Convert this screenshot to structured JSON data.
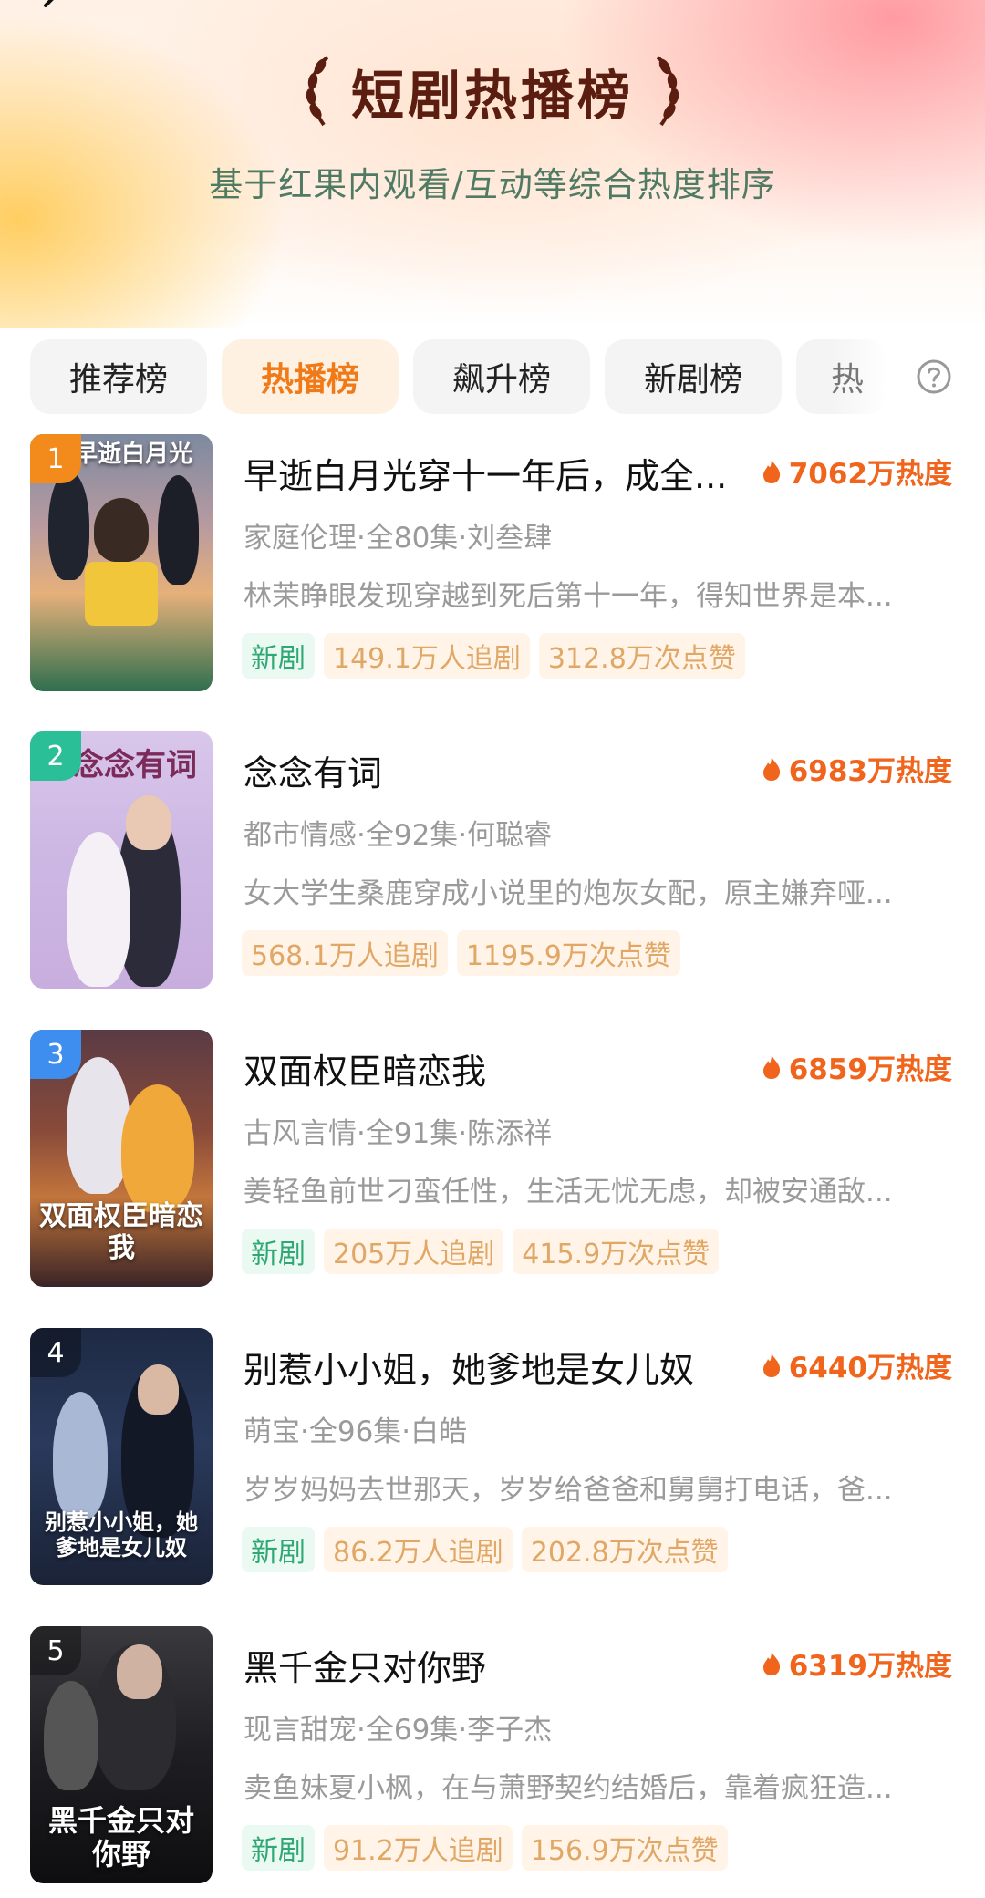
{
  "header": {
    "title": "短剧热播榜",
    "subtitle": "基于红果内观看/互动等综合热度排序"
  },
  "tabs": [
    {
      "label": "推荐榜"
    },
    {
      "label": "热播榜"
    },
    {
      "label": "飙升榜"
    },
    {
      "label": "新剧榜"
    },
    {
      "label": "热"
    }
  ],
  "active_tab": "热播榜",
  "accent_color": "#f0641c",
  "items": [
    {
      "rank": "1",
      "rank_color": "#f28a1c",
      "poster_text": "早逝白月光",
      "title": "早逝白月光穿十一年后，成全...",
      "heat": "7062万热度",
      "meta": "家庭伦理·全80集·刘叁肆",
      "desc": "林茉睁眼发现穿越到死后第十一年，得知世界是本...",
      "tag_new": "新剧",
      "followers": "149.1万人追剧",
      "likes": "312.8万次点赞"
    },
    {
      "rank": "2",
      "rank_color": "#2bbf98",
      "poster_text": "念念有词",
      "title": "念念有词",
      "heat": "6983万热度",
      "meta": "都市情感·全92集·何聪睿",
      "desc": "女大学生桑鹿穿成小说里的炮灰女配，原主嫌弃哑...",
      "tag_new": "",
      "followers": "568.1万人追剧",
      "likes": "1195.9万次点赞"
    },
    {
      "rank": "3",
      "rank_color": "#3e8ef0",
      "poster_text": "双面权臣暗恋我",
      "title": "双面权臣暗恋我",
      "heat": "6859万热度",
      "meta": "古风言情·全91集·陈添祥",
      "desc": "姜轻鱼前世刁蛮任性，生活无忧无虑，却被安通敌...",
      "tag_new": "新剧",
      "followers": "205万人追剧",
      "likes": "415.9万次点赞"
    },
    {
      "rank": "4",
      "rank_color": "rgba(0,0,0,0.35)",
      "poster_text": "别惹小小姐，她爹地是女儿奴",
      "title": "别惹小小姐，她爹地是女儿奴",
      "heat": "6440万热度",
      "meta": "萌宝·全96集·白皓",
      "desc": "岁岁妈妈去世那天，岁岁给爸爸和舅舅打电话，爸...",
      "tag_new": "新剧",
      "followers": "86.2万人追剧",
      "likes": "202.8万次点赞"
    },
    {
      "rank": "5",
      "rank_color": "rgba(0,0,0,0.35)",
      "poster_text": "黑千金只对你野",
      "title": "黑千金只对你野",
      "heat": "6319万热度",
      "meta": "现言甜宠·全69集·李子杰",
      "desc": "卖鱼妹夏小枫，在与萧野契约结婚后，靠着疯狂造...",
      "tag_new": "新剧",
      "followers": "91.2万人追剧",
      "likes": "156.9万次点赞"
    }
  ]
}
